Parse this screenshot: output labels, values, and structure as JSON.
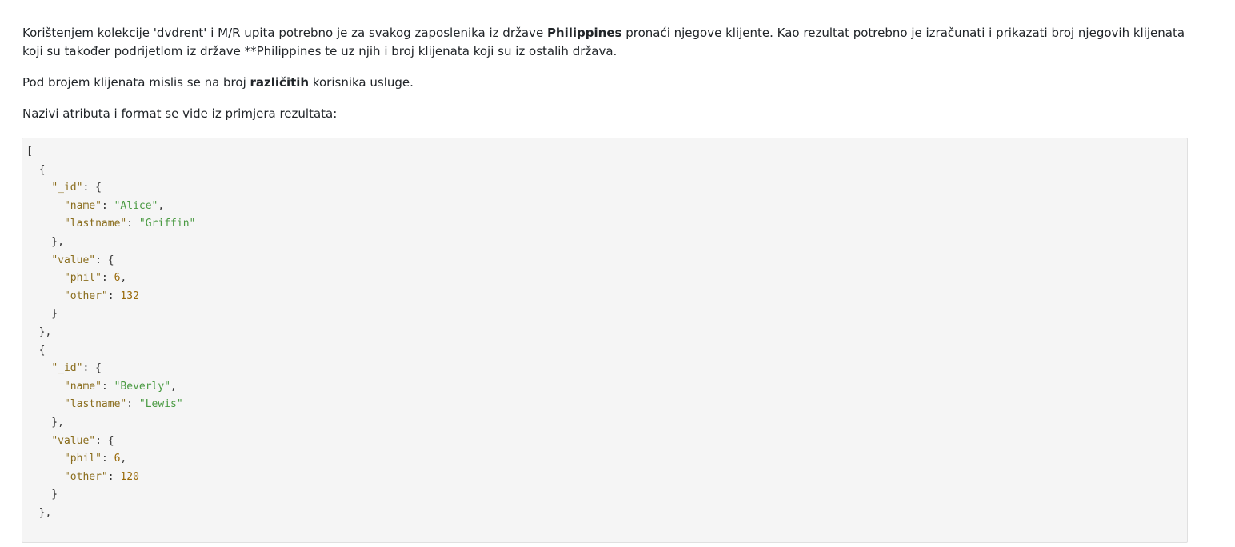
{
  "intro": {
    "p1_a": "Korištenjem kolekcije 'dvdrent' i M/R upita potrebno je za svakog zaposlenika iz države ",
    "p1_bold": "Philippines",
    "p1_b": " pronaći njegove klijente. Kao rezultat potrebno je izračunati i prikazati broj njegovih klijenata koji su također podrijetlom iz države **Philippines te uz njih i broj klijenata koji su iz ostalih država.",
    "p2_a": "Pod brojem klijenata mislis se na broj ",
    "p2_bold": "različitih",
    "p2_b": " korisnika usluge.",
    "p3": "Nazivi atributa i format se vide iz primjera rezultata:"
  },
  "code": {
    "open_bracket": "[",
    "keys": {
      "id": "\"_id\"",
      "name": "\"name\"",
      "lastname": "\"lastname\"",
      "value": "\"value\"",
      "phil": "\"phil\"",
      "other": "\"other\""
    },
    "records": [
      {
        "name": "\"Alice\"",
        "lastname": "\"Griffin\"",
        "phil": "6",
        "other": "132"
      },
      {
        "name": "\"Beverly\"",
        "lastname": "\"Lewis\"",
        "phil": "6",
        "other": "120"
      }
    ]
  }
}
